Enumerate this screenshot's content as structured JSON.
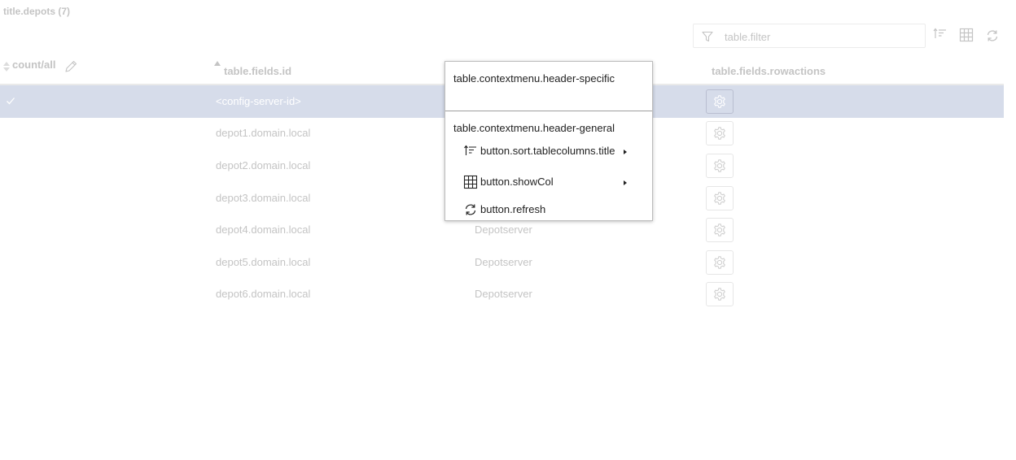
{
  "page": {
    "title": "title.depots (7)"
  },
  "toolbar": {
    "filter_placeholder": "table.filter",
    "icons": [
      "filter-icon",
      "sort-icon",
      "columns-grid-icon",
      "refresh-icon"
    ]
  },
  "table": {
    "headers": {
      "select": "count/all",
      "id": "table.fields.id",
      "rowactions": "table.fields.rowactions"
    },
    "rows": [
      {
        "id": "<config-server-id>",
        "type": "",
        "selected": true
      },
      {
        "id": "depot1.domain.local",
        "type": "",
        "selected": false
      },
      {
        "id": "depot2.domain.local",
        "type": "",
        "selected": false
      },
      {
        "id": "depot3.domain.local",
        "type": "",
        "selected": false
      },
      {
        "id": "depot4.domain.local",
        "type": "Depotserver",
        "selected": false
      },
      {
        "id": "depot5.domain.local",
        "type": "Depotserver",
        "selected": false
      },
      {
        "id": "depot6.domain.local",
        "type": "Depotserver",
        "selected": false
      }
    ]
  },
  "context_menu": {
    "header_specific": "table.contextmenu.header-specific",
    "header_general": "table.contextmenu.header-general",
    "items": [
      {
        "label": "button.sort.tablecolumns.title",
        "icon": "sort-icon",
        "submenu": true
      },
      {
        "label": "button.showCol",
        "icon": "columns-grid-icon",
        "submenu": true
      },
      {
        "label": "button.refresh",
        "icon": "refresh-icon",
        "submenu": false
      }
    ]
  },
  "colors": {
    "selected_row": "#d6dcea",
    "muted_text": "#c4c4c4",
    "menu_text": "#222222"
  }
}
